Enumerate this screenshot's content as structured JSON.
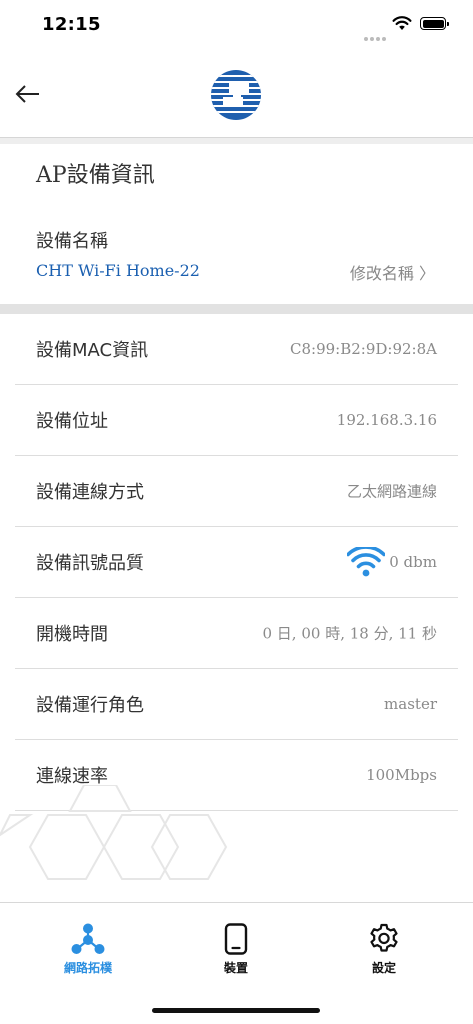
{
  "status_bar": {
    "time": "12:15"
  },
  "nav": {
    "back_icon": "arrow-left-icon",
    "logo": "cht-logo"
  },
  "ap_info": {
    "title": "AP設備資訊",
    "name_label": "設備名稱",
    "device_name": "CHT Wi-Fi Home-22",
    "rename_link": "修改名稱 〉"
  },
  "info_rows": [
    {
      "label": "設備MAC資訊",
      "value": "C8:99:B2:9D:92:8A"
    },
    {
      "label": "設備位址",
      "value": "192.168.3.16"
    },
    {
      "label": "設備連線方式",
      "value": "乙太網路連線"
    },
    {
      "label": "設備訊號品質",
      "value": "0 dbm",
      "icon": "wifi-signal-icon"
    },
    {
      "label": "開機時間",
      "value": "0 日, 00 時, 18 分, 11 秒"
    },
    {
      "label": "設備運行角色",
      "value": "master"
    },
    {
      "label": "連線速率",
      "value": "100Mbps"
    }
  ],
  "tabs": [
    {
      "label": "網路拓樸",
      "icon": "network-topology-icon",
      "active": true
    },
    {
      "label": "裝置",
      "icon": "phone-device-icon",
      "active": false
    },
    {
      "label": "設定",
      "icon": "gear-icon",
      "active": false
    }
  ],
  "colors": {
    "accent": "#2b8fe0",
    "link": "#1a5fb0",
    "logo_blue": "#1f5fae"
  }
}
